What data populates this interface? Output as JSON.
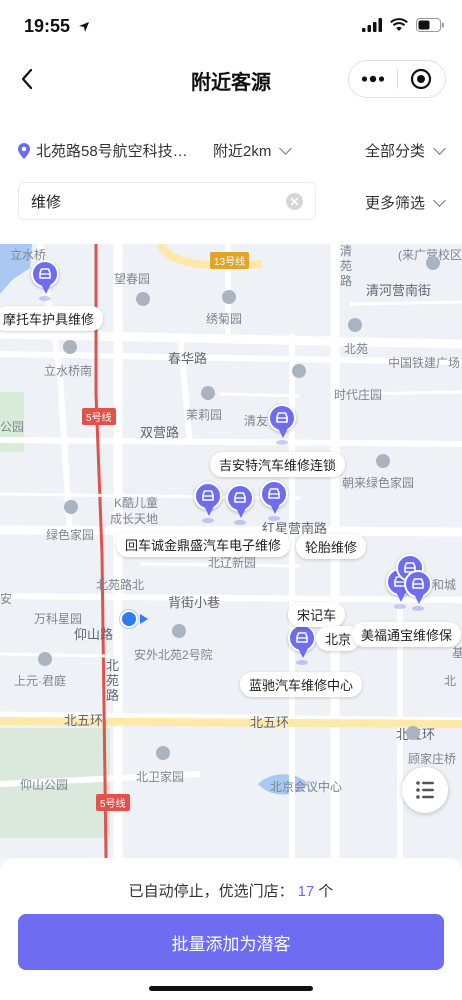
{
  "status_bar": {
    "time": "19:55"
  },
  "nav": {
    "title": "附近客源"
  },
  "filters": {
    "location": "北苑路58号航空科技…",
    "radius": "附近2km",
    "category": "全部分类",
    "search_value": "维修",
    "more_filter": "更多筛选"
  },
  "map": {
    "place_labels": {
      "lishuiqiao_top": "立水桥",
      "wangchunyuan": "望春园",
      "xiuju": "绣菊园",
      "qingyuan": "清\n苑\n路",
      "qingheyingdong": "清河营南街",
      "laiguangying": "(来广营校区)",
      "lishuiqiaonan": "立水桥南",
      "chunhua": "春华路",
      "beiyuan": "北苑",
      "zhongguotielu": "中国铁建广场",
      "shidaizhuangyuan": "时代庄园",
      "gongyuan": "公园",
      "shuangying": "双营路",
      "moliyuan": "茉莉园",
      "qingyou": "清友",
      "chaolai": "朝来绿色家园",
      "kuer": "K酷儿童",
      "chengzhang": "成长天地",
      "hongxingying": "红星营南路",
      "lvsejiayuan": "绿色家园",
      "beiyuanlubei": "北苑路北",
      "beiyuanxincheng": "北辽新园",
      "beixiaoxiang": "背街小巷",
      "wankexingyuan": "万科星园",
      "yangshan": "仰山路",
      "beiyuanlu": "北\n苑\n路",
      "anwaibeiyuan2": "安外北苑2号院",
      "shangyuanjun": "上元·君庭",
      "beiwuhuan": "北五环",
      "beiwuhuan2": "北五环",
      "beiwuhuan3": "北五环",
      "yangshangongyuan": "仰山公园",
      "beiweijiayuan": "北卫家园",
      "beijinghuiyi": "北京会议中心",
      "guyingzhuangqiao": "顾家庄桥",
      "an": "安",
      "ji": "基",
      "beiyuan_right": "北",
      "hoccheng": "和城"
    },
    "badges": {
      "line13": "13号线",
      "line5a": "5号线",
      "line5b": "5号线"
    },
    "shops": [
      "摩托车护具维修",
      "吉安特汽车维修连锁",
      "回车诚金鼎盛汽车电子维修",
      "轮胎维修",
      "宋记车",
      "北京",
      "美福通宝维修保",
      "蓝驰汽车维修中心"
    ]
  },
  "bottom": {
    "stop_prefix": "已自动停止，优选门店：",
    "stop_count": "17",
    "stop_suffix": "个",
    "cta_label": "批量添加为潜客"
  },
  "colors": {
    "accent": "#6e6cf1",
    "location_dot": "#2f7bf0"
  }
}
